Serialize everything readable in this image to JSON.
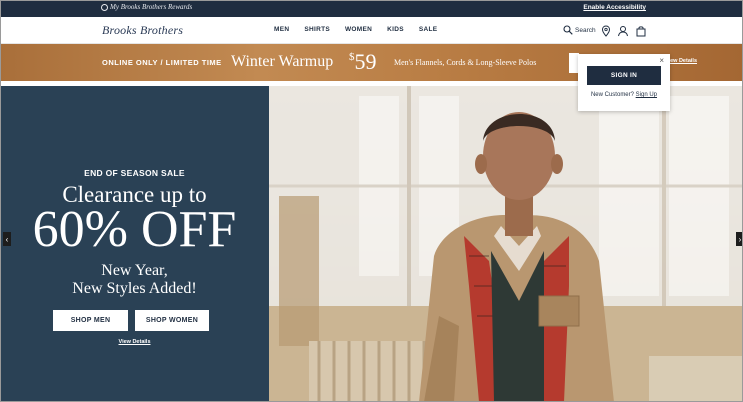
{
  "topbar": {
    "rewards": "My Brooks Brothers Rewards",
    "accessibility": "Enable Accessibility"
  },
  "header": {
    "logo": "Brooks Brothers",
    "nav": [
      "MEN",
      "SHIRTS",
      "WOMEN",
      "KIDS",
      "SALE"
    ],
    "search_label": "Search"
  },
  "promo": {
    "limited": "ONLINE ONLY / LIMITED TIME",
    "title": "Winter Warmup",
    "price_symbol": "$",
    "price_value": "59",
    "description": "Men's Flannels, Cords & Long-Sleeve Polos",
    "details": "View Details"
  },
  "popover": {
    "close": "×",
    "signin": "SIGN IN",
    "new_customer": "New Customer?",
    "signup": "Sign Up"
  },
  "hero": {
    "eyebrow": "END OF SEASON SALE",
    "headline": "Clearance up to",
    "big": "60% OFF",
    "sub_line1": "New Year,",
    "sub_line2": "New Styles Added!",
    "shop_men": "SHOP MEN",
    "shop_women": "SHOP WOMEN",
    "view_details": "View Details"
  },
  "carousel": {
    "prev": "‹",
    "next": "›"
  },
  "colors": {
    "navy": "#1f2d40",
    "hero_panel": "#2a4155",
    "promo_bronze": "#b97d44"
  }
}
